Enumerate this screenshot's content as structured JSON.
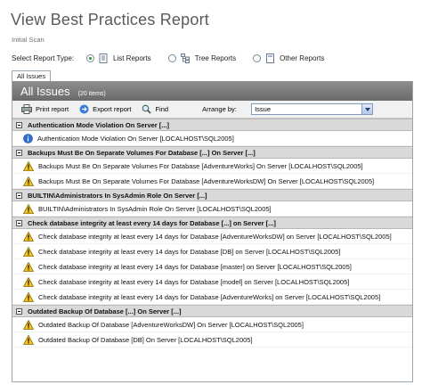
{
  "header": {
    "title": "View Best Practices Report",
    "subtitle": "Initial Scan"
  },
  "report_type": {
    "label": "Select Report Type:",
    "options": [
      {
        "label": "List Reports",
        "selected": true,
        "icon": "list-report-icon"
      },
      {
        "label": "Tree Reports",
        "selected": false,
        "icon": "tree-report-icon"
      },
      {
        "label": "Other Reports",
        "selected": false,
        "icon": "other-report-icon"
      }
    ]
  },
  "tabs": [
    "All Issues"
  ],
  "banner": {
    "title": "All Issues",
    "count": "(20 items)"
  },
  "toolbar": {
    "print": "Print report",
    "export": "Export report",
    "find": "Find",
    "arrange_label": "Arrange by:",
    "arrange_value": "Issue"
  },
  "groups": [
    {
      "title": "Authentication Mode Violation On Server [...]",
      "items": [
        {
          "severity": "info",
          "text": "Authentication Mode Violation On Server [LOCALHOST\\SQL2005]"
        }
      ]
    },
    {
      "title": "Backups Must Be On Separate Volumes For Database [...] On Server [...]",
      "items": [
        {
          "severity": "warning",
          "text": "Backups Must Be On Separate Volumes For Database [AdventureWorks] On Server [LOCALHOST\\SQL2005]"
        },
        {
          "severity": "warning",
          "text": "Backups Must Be On Separate Volumes For Database [AdventureWorksDW] On Server [LOCALHOST\\SQL2005]"
        }
      ]
    },
    {
      "title": "BUILTIN\\Administrators In SysAdmin Role On Server [...]",
      "items": [
        {
          "severity": "warning",
          "text": "BUILTIN\\Administrators In SysAdmin Role On Server [LOCALHOST\\SQL2005]"
        }
      ]
    },
    {
      "title": "Check database integrity at least every 14 days for Database [...] on Server [...]",
      "items": [
        {
          "severity": "warning",
          "text": "Check database integrity at least every 14 days for Database [AdventureWorksDW] on Server [LOCALHOST\\SQL2005]"
        },
        {
          "severity": "warning",
          "text": "Check database integrity at least every 14 days for Database [DB] on Server [LOCALHOST\\SQL2005]"
        },
        {
          "severity": "warning",
          "text": "Check database integrity at least every 14 days for Database [master] on Server [LOCALHOST\\SQL2005]"
        },
        {
          "severity": "warning",
          "text": "Check database integrity at least every 14 days for Database [model] on Server [LOCALHOST\\SQL2005]"
        },
        {
          "severity": "warning",
          "text": "Check database integrity at least every 14 days for Database [AdventureWorks] on Server [LOCALHOST\\SQL2005]"
        }
      ]
    },
    {
      "title": "Outdated Backup Of Database [...] On Server [...]",
      "items": [
        {
          "severity": "warning",
          "text": "Outdated Backup Of Database [AdventureWorksDW] On Server [LOCALHOST\\SQL2005]"
        },
        {
          "severity": "warning",
          "text": "Outdated Backup Of Database [DB] On Server [LOCALHOST\\SQL2005]"
        }
      ]
    }
  ],
  "colors": {
    "banner": "#7a7a7a",
    "group_header": "#d9d9d9",
    "warning": "#f2c21b",
    "info": "#2f6fd0"
  }
}
